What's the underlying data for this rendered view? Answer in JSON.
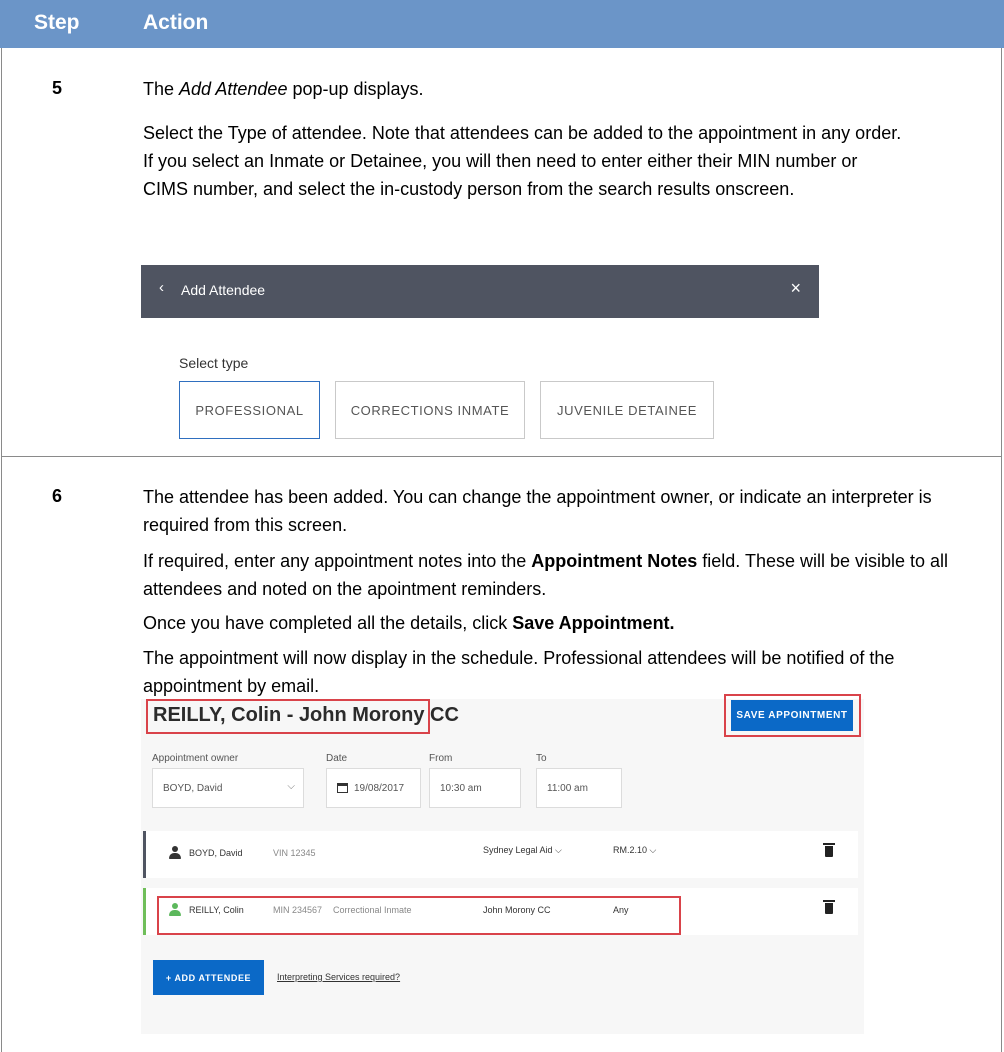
{
  "table": {
    "header": {
      "step": "Step",
      "action": "Action"
    }
  },
  "step5": {
    "number": "5",
    "intro_pre": "The ",
    "intro_em": "Add Attendee",
    "intro_post": " pop-up displays.",
    "body": "Select the Type of attendee. Note that attendees can be added to the appointment in any order. If you select an Inmate or Detainee, you will then need to enter either their MIN number or CIMS number, and select the in-custody person from the search results onscreen.",
    "popup": {
      "back_glyph": "‹",
      "title": "Add Attendee",
      "close_glyph": "×",
      "select_label": "Select type",
      "types": [
        "PROFESSIONAL",
        "CORRECTIONS INMATE",
        "JUVENILE DETAINEE"
      ]
    }
  },
  "step6": {
    "number": "6",
    "p1": "The attendee has been added. You can change the appointment owner, or indicate an interpreter is required from this screen.",
    "p2_pre": "If required, enter any appointment notes into the ",
    "p2_bold": "Appointment Notes",
    "p2_post": " field. These will be visible to all attendees and noted on the apointment reminders.",
    "p3_pre": "Once you have completed all the details, click ",
    "p3_bold": "Save Appointment.",
    "p4": "The appointment will now display in the schedule. Professional attendees will be notified of the appointment by email.",
    "appointment": {
      "title": "REILLY, Colin - John Morony CC",
      "save_label": "SAVE APPOINTMENT",
      "owner_label": "Appointment owner",
      "owner_value": "BOYD, David",
      "date_label": "Date",
      "date_value": "19/08/2017",
      "from_label": "From",
      "from_value": "10:30 am",
      "to_label": "To",
      "to_value": "11:00 am",
      "chevron": "⌵",
      "attendees": [
        {
          "name": "BOYD, David",
          "id": "VIN 12345",
          "type": "",
          "location": "Sydney Legal Aid ⌵",
          "room": "RM.2.10 ⌵"
        },
        {
          "name": "REILLY, Colin",
          "id": "MIN 234567",
          "type": "Correctional Inmate",
          "location": "John Morony CC",
          "room": "Any"
        }
      ],
      "add_attendee_label": "+ ADD ATTENDEE",
      "interpreter_link": "Interpreting Services required?"
    }
  },
  "colors": {
    "header_bg": "#6b95c8",
    "highlight": "#d9434a",
    "primary_button": "#0b69c7",
    "popup_bar": "#4f5461"
  }
}
